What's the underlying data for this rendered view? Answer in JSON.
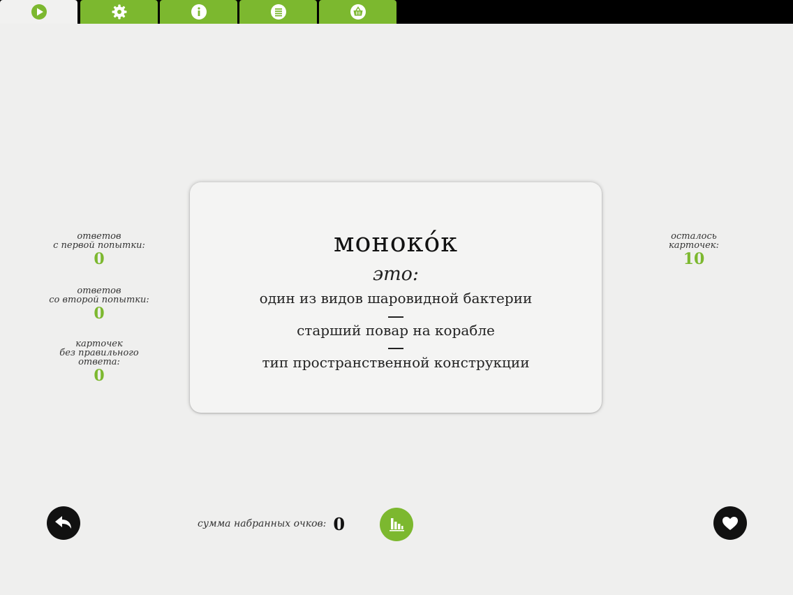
{
  "tabs": [
    {
      "icon": "play-icon",
      "active": true
    },
    {
      "icon": "gear-icon",
      "active": false
    },
    {
      "icon": "info-icon",
      "active": false
    },
    {
      "icon": "list-icon",
      "active": false
    },
    {
      "icon": "basket-icon",
      "active": false
    }
  ],
  "card": {
    "word": "монокóк",
    "prompt": "это:",
    "options": [
      "один из видов шаровидной бактерии",
      "старший повар на корабле",
      "тип пространственной конструкции"
    ]
  },
  "stats_left": [
    {
      "label": "ответов\nс первой попытки:",
      "value": "0"
    },
    {
      "label": "ответов\nсо второй попытки:",
      "value": "0"
    },
    {
      "label": "карточек\nбез правильного\nответа:",
      "value": "0"
    }
  ],
  "stats_right": {
    "label": "осталось\nкарточек:",
    "value": "10"
  },
  "score": {
    "label": "сумма набранных очков:",
    "value": "0"
  },
  "buttons": {
    "back": "back-arrow-icon",
    "stats": "bar-chart-icon",
    "favorite": "heart-icon"
  },
  "colors": {
    "accent": "#7cb82f",
    "background": "#efefee",
    "topbar": "#000000"
  }
}
